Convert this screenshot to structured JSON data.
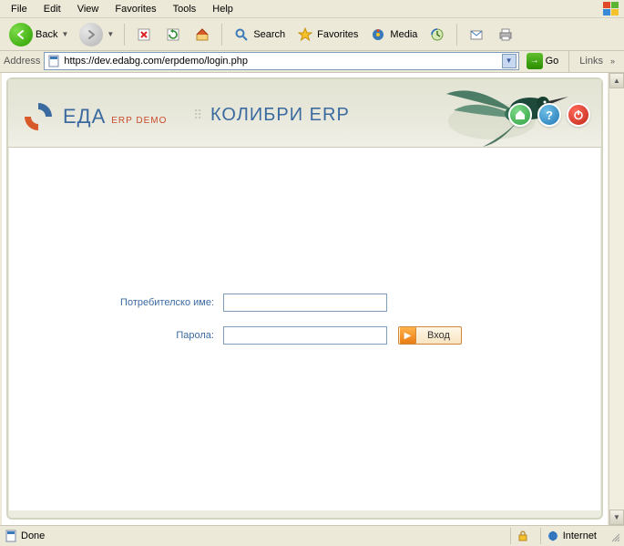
{
  "menubar": [
    "File",
    "Edit",
    "View",
    "Favorites",
    "Tools",
    "Help"
  ],
  "toolbar": {
    "back": "Back",
    "search": "Search",
    "favorites": "Favorites",
    "media": "Media"
  },
  "address": {
    "label": "Address",
    "url": "https://dev.edabg.com/erpdemo/login.php",
    "go": "Go",
    "links": "Links"
  },
  "header": {
    "brand_main": "ЕДА",
    "brand_sub": "ERP DEMO",
    "product": "КОЛИБРИ ERP"
  },
  "form": {
    "username_label": "Потребителско име:",
    "password_label": "Парола:",
    "login_button": "Вход"
  },
  "status": {
    "done": "Done",
    "zone": "Internet"
  }
}
